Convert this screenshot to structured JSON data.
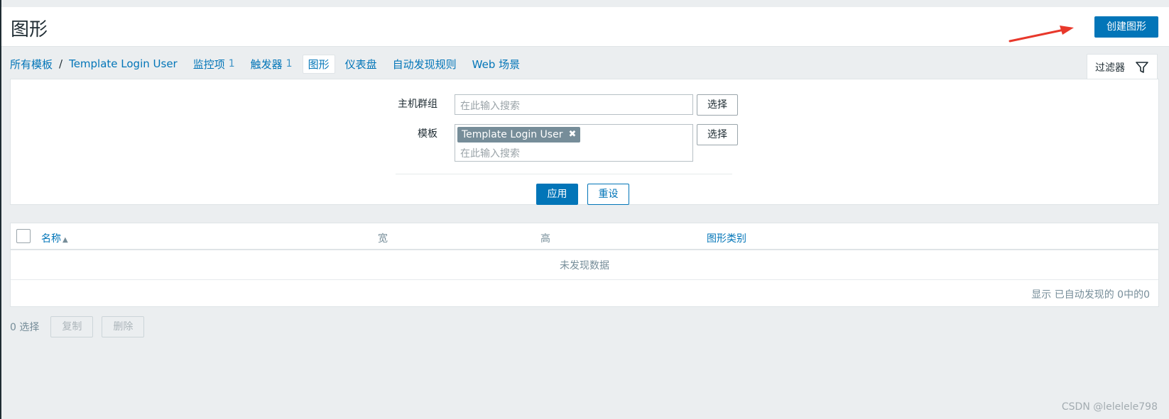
{
  "header": {
    "title": "图形",
    "create_button": "创建图形"
  },
  "nav": {
    "all_templates": "所有模板",
    "template_name": "Template Login User",
    "items": [
      {
        "label": "监控项",
        "count": "1"
      },
      {
        "label": "触发器",
        "count": "1"
      },
      {
        "label": "图形",
        "count": ""
      },
      {
        "label": "仪表盘",
        "count": ""
      },
      {
        "label": "自动发现规则",
        "count": ""
      },
      {
        "label": "Web 场景",
        "count": ""
      }
    ]
  },
  "filter": {
    "tab_label": "过滤器",
    "host_group_label": "主机群组",
    "host_group_placeholder": "在此输入搜索",
    "template_label": "模板",
    "template_chip": "Template Login User",
    "template_placeholder": "在此输入搜索",
    "select_button": "选择",
    "apply_button": "应用",
    "reset_button": "重设"
  },
  "table": {
    "columns": [
      "名称",
      "宽",
      "高",
      "图形类别"
    ],
    "empty_text": "未发现数据",
    "paging_text": "显示 已自动发现的 0中的0"
  },
  "actions": {
    "selected_text": "0 选择",
    "copy_button": "复制",
    "delete_button": "删除"
  },
  "watermark": "CSDN @lelelele798",
  "colors": {
    "accent": "#0275b8",
    "annotation_arrow": "#e8382b"
  }
}
